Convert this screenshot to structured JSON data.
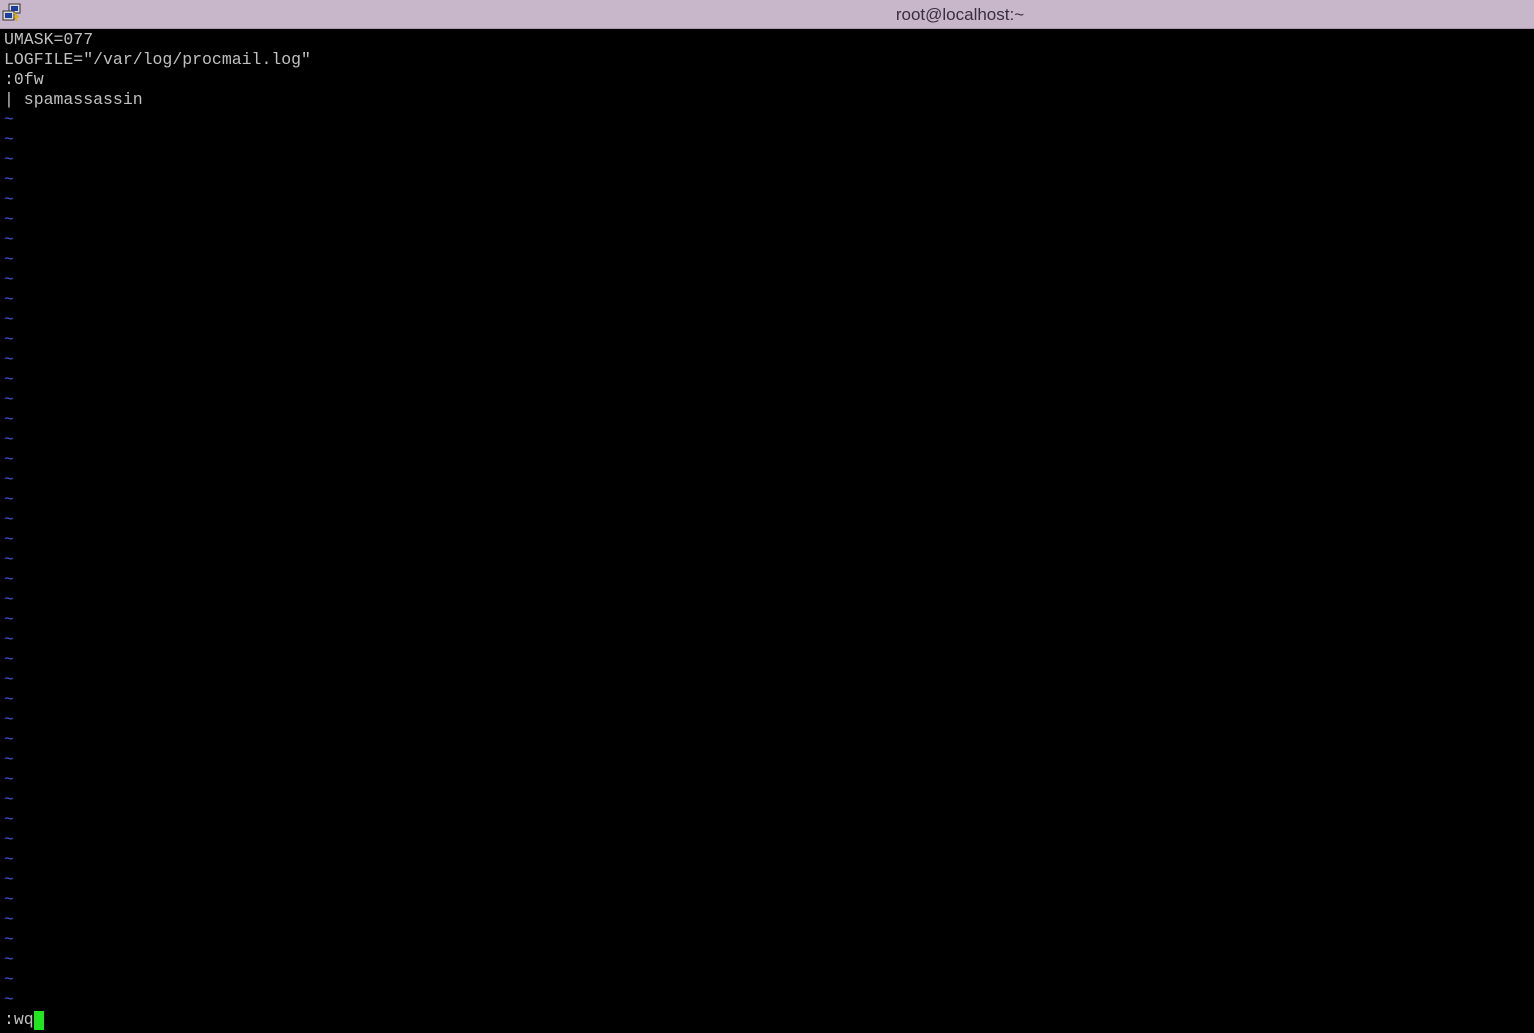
{
  "window": {
    "title": "root@localhost:~",
    "icon": "putty-terminal-icon"
  },
  "editor": {
    "lines": [
      "UMASK=077",
      "LOGFILE=\"/var/log/procmail.log\"",
      ":0fw",
      "| spamassassin"
    ],
    "empty_marker": "~",
    "empty_line_count": 45,
    "command_line": ":wq"
  },
  "colors": {
    "background": "#000000",
    "text": "#c0c0c0",
    "tilde": "#3f58d6",
    "cursor": "#1fe61f",
    "titlebar": "#c8b6cb"
  }
}
